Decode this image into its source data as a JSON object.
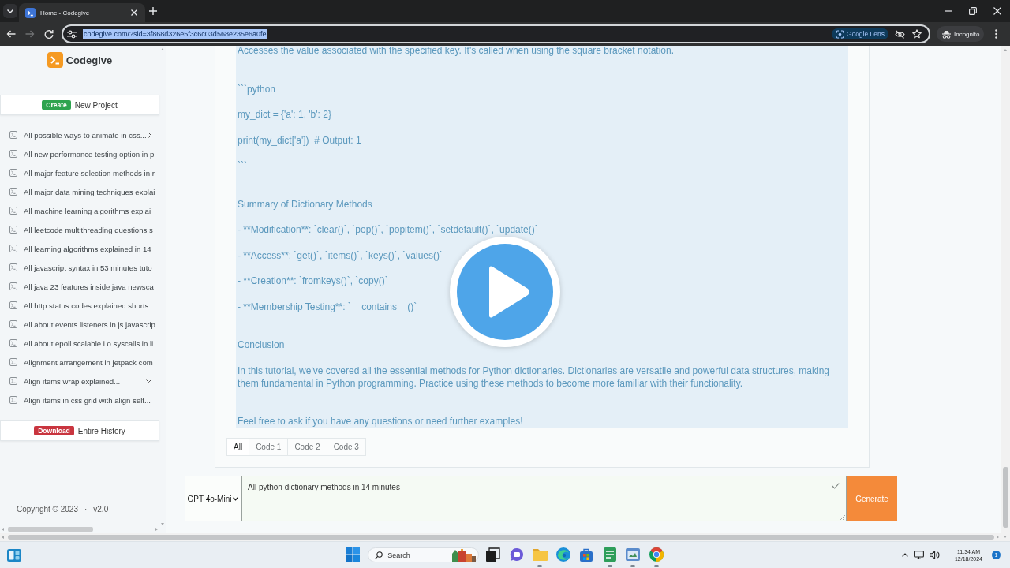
{
  "browser": {
    "tab_title": "Home - Codegive",
    "forward_disabled": true,
    "url": "codegive.com/?sid=3f868d326e5f3c6c03d568e235e6a0fe",
    "url_selected": true,
    "lens_label": "Google Lens",
    "profile_label": "Incognito"
  },
  "sidebar": {
    "brand": "Codegive",
    "create_button": {
      "tag": "Create",
      "label": "New Project"
    },
    "history": [
      {
        "title": "All possible ways to animate in css...",
        "kind": "more"
      },
      {
        "title": "All new performance testing option in p",
        "kind": "plain"
      },
      {
        "title": "All major feature selection methods in r",
        "kind": "plain"
      },
      {
        "title": "All major data mining techniques explai",
        "kind": "plain"
      },
      {
        "title": "All machine learning algorithms explai",
        "kind": "plain"
      },
      {
        "title": "All leetcode multithreading questions s",
        "kind": "plain"
      },
      {
        "title": "All learning algorithms explained in 14",
        "kind": "plain"
      },
      {
        "title": "All javascript syntax in 53 minutes tuto",
        "kind": "plain"
      },
      {
        "title": "All java 23 features inside java newsca",
        "kind": "plain"
      },
      {
        "title": "All http status codes explained shorts",
        "kind": "plain"
      },
      {
        "title": "All about events listeners in js javascrip",
        "kind": "plain"
      },
      {
        "title": "All about epoll scalable i o syscalls in li",
        "kind": "plain"
      },
      {
        "title": "Alignment arrangement in jetpack com",
        "kind": "plain"
      },
      {
        "title": "Align items wrap explained...",
        "kind": "expand"
      },
      {
        "title": "Align items in css grid with align self...",
        "kind": "more"
      }
    ],
    "download_button": {
      "tag": "Download",
      "label": "Entire History"
    },
    "footer": {
      "copyright": "Copyright © 2023",
      "separator": "·",
      "version": "v2.0"
    }
  },
  "response": {
    "blocks": [
      [
        "Accesses the value associated with the specified key. It's called when using the square bracket notation."
      ],
      [
        "```python",
        "my_dict = {'a': 1, 'b': 2}",
        "print(my_dict['a'])  # Output: 1",
        "```"
      ],
      [
        "Summary of Dictionary Methods",
        "- **Modification**: `clear()`, `pop()`, `popitem()`, `setdefault()`, `update()`",
        "- **Access**: `get()`, `items()`, `keys()`, `values()`",
        "- **Creation**: `fromkeys()`, `copy()`",
        "- **Membership Testing**: `__contains__()`"
      ],
      [
        "Conclusion",
        "In this tutorial, we've covered all the essential methods for Python dictionaries. Dictionaries are versatile and powerful data structures, making them fundamental in Python programming. Practice using these methods to become more familiar with their functionality."
      ],
      [
        "Feel free to ask if you have any questions or need further examples!"
      ]
    ],
    "tabs": [
      {
        "label": "All",
        "selected": true
      },
      {
        "label": "Code 1",
        "selected": false
      },
      {
        "label": "Code 2",
        "selected": false
      },
      {
        "label": "Code 3",
        "selected": false
      }
    ]
  },
  "prompt_bar": {
    "model": "GPT 4o-Mini",
    "prompt": "All python dictionary methods in 14 minutes",
    "submit_label": "Generate"
  },
  "taskbar": {
    "search_label": "Search",
    "apps": [
      {
        "kind": "task-view",
        "running": false
      },
      {
        "kind": "chat",
        "running": false
      },
      {
        "kind": "folder",
        "running": true
      },
      {
        "kind": "edge",
        "running": false
      },
      {
        "kind": "store",
        "running": false
      },
      {
        "kind": "notes",
        "running": true
      },
      {
        "kind": "snip",
        "running": true
      },
      {
        "kind": "chrome",
        "running": true
      }
    ],
    "time": "11:34 AM",
    "date": "12/18/2024",
    "notification_count": "1"
  }
}
